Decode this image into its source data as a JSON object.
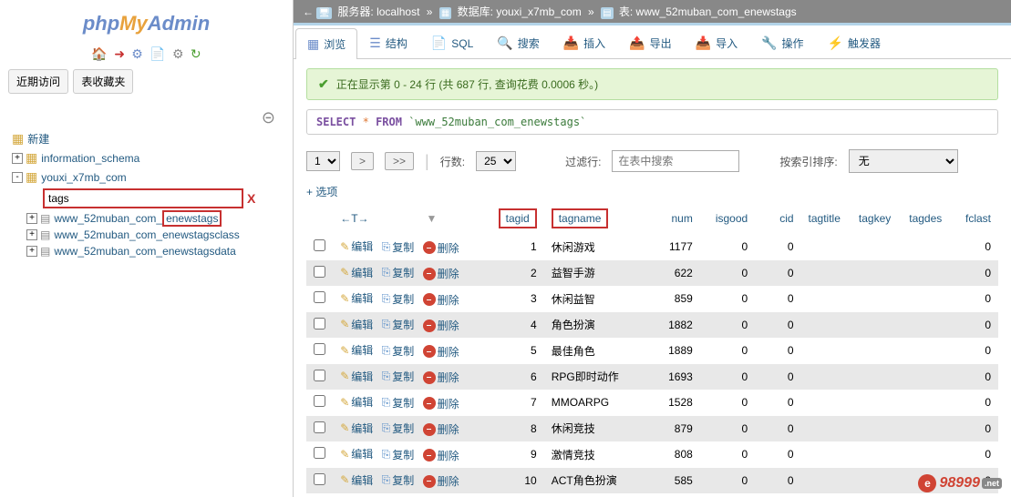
{
  "logo": {
    "php": "php",
    "my": "My",
    "admin": "Admin"
  },
  "nav": {
    "recent": "近期访问",
    "favorites": "表收藏夹"
  },
  "tree": {
    "new": "新建",
    "db1": "information_schema",
    "db2": "youxi_x7mb_com",
    "filter": "tags",
    "table1_prefix": "www_52muban_com_",
    "table1_suffix": "enewstags",
    "table2": "www_52muban_com_enewstagsclass",
    "table3": "www_52muban_com_enewstagsdata"
  },
  "breadcrumb": {
    "server_label": "服务器:",
    "server": "localhost",
    "db_label": "数据库:",
    "db": "youxi_x7mb_com",
    "table_label": "表:",
    "table": "www_52muban_com_enewstags"
  },
  "tabs": {
    "browse": "浏览",
    "structure": "结构",
    "sql": "SQL",
    "search": "搜索",
    "insert": "插入",
    "export": "导出",
    "import": "导入",
    "operations": "操作",
    "triggers": "触发器"
  },
  "success": "正在显示第 0 - 24 行 (共 687 行, 查询花费 0.0006 秒。)",
  "sql": {
    "select": "SELECT",
    "star": "*",
    "from": "FROM",
    "table": "`www_52muban_com_enewstags`"
  },
  "pagination": {
    "page": "1",
    "rows_label": "行数:",
    "rows": "25",
    "filter_label": "过滤行:",
    "search_placeholder": "在表中搜索",
    "index_label": "按索引排序:",
    "index_value": "无"
  },
  "options": "+ 选项",
  "headers": {
    "tagid": "tagid",
    "tagname": "tagname",
    "num": "num",
    "isgood": "isgood",
    "cid": "cid",
    "tagtitle": "tagtitle",
    "tagkey": "tagkey",
    "tagdes": "tagdes",
    "fclast": "fclast"
  },
  "actions": {
    "edit": "编辑",
    "copy": "复制",
    "delete": "删除"
  },
  "chart_data": {
    "type": "table",
    "columns": [
      "tagid",
      "tagname",
      "num",
      "isgood",
      "cid",
      "tagtitle",
      "tagkey",
      "tagdes",
      "fclast"
    ],
    "rows": [
      {
        "tagid": 1,
        "tagname": "休闲游戏",
        "num": 1177,
        "isgood": 0,
        "cid": 0,
        "fclast": 0
      },
      {
        "tagid": 2,
        "tagname": "益智手游",
        "num": 622,
        "isgood": 0,
        "cid": 0,
        "fclast": 0
      },
      {
        "tagid": 3,
        "tagname": "休闲益智",
        "num": 859,
        "isgood": 0,
        "cid": 0,
        "fclast": 0
      },
      {
        "tagid": 4,
        "tagname": "角色扮演",
        "num": 1882,
        "isgood": 0,
        "cid": 0,
        "fclast": 0
      },
      {
        "tagid": 5,
        "tagname": "最佳角色",
        "num": 1889,
        "isgood": 0,
        "cid": 0,
        "fclast": 0
      },
      {
        "tagid": 6,
        "tagname": "RPG即时动作",
        "num": 1693,
        "isgood": 0,
        "cid": 0,
        "fclast": 0
      },
      {
        "tagid": 7,
        "tagname": "MMOARPG",
        "num": 1528,
        "isgood": 0,
        "cid": 0,
        "fclast": 0
      },
      {
        "tagid": 8,
        "tagname": "休闲竞技",
        "num": 879,
        "isgood": 0,
        "cid": 0,
        "fclast": 0
      },
      {
        "tagid": 9,
        "tagname": "激情竞技",
        "num": 808,
        "isgood": 0,
        "cid": 0,
        "fclast": 0
      },
      {
        "tagid": 10,
        "tagname": "ACT角色扮演",
        "num": 585,
        "isgood": 0,
        "cid": 0,
        "fclast": 0
      }
    ]
  },
  "bottom_logo": "98999"
}
